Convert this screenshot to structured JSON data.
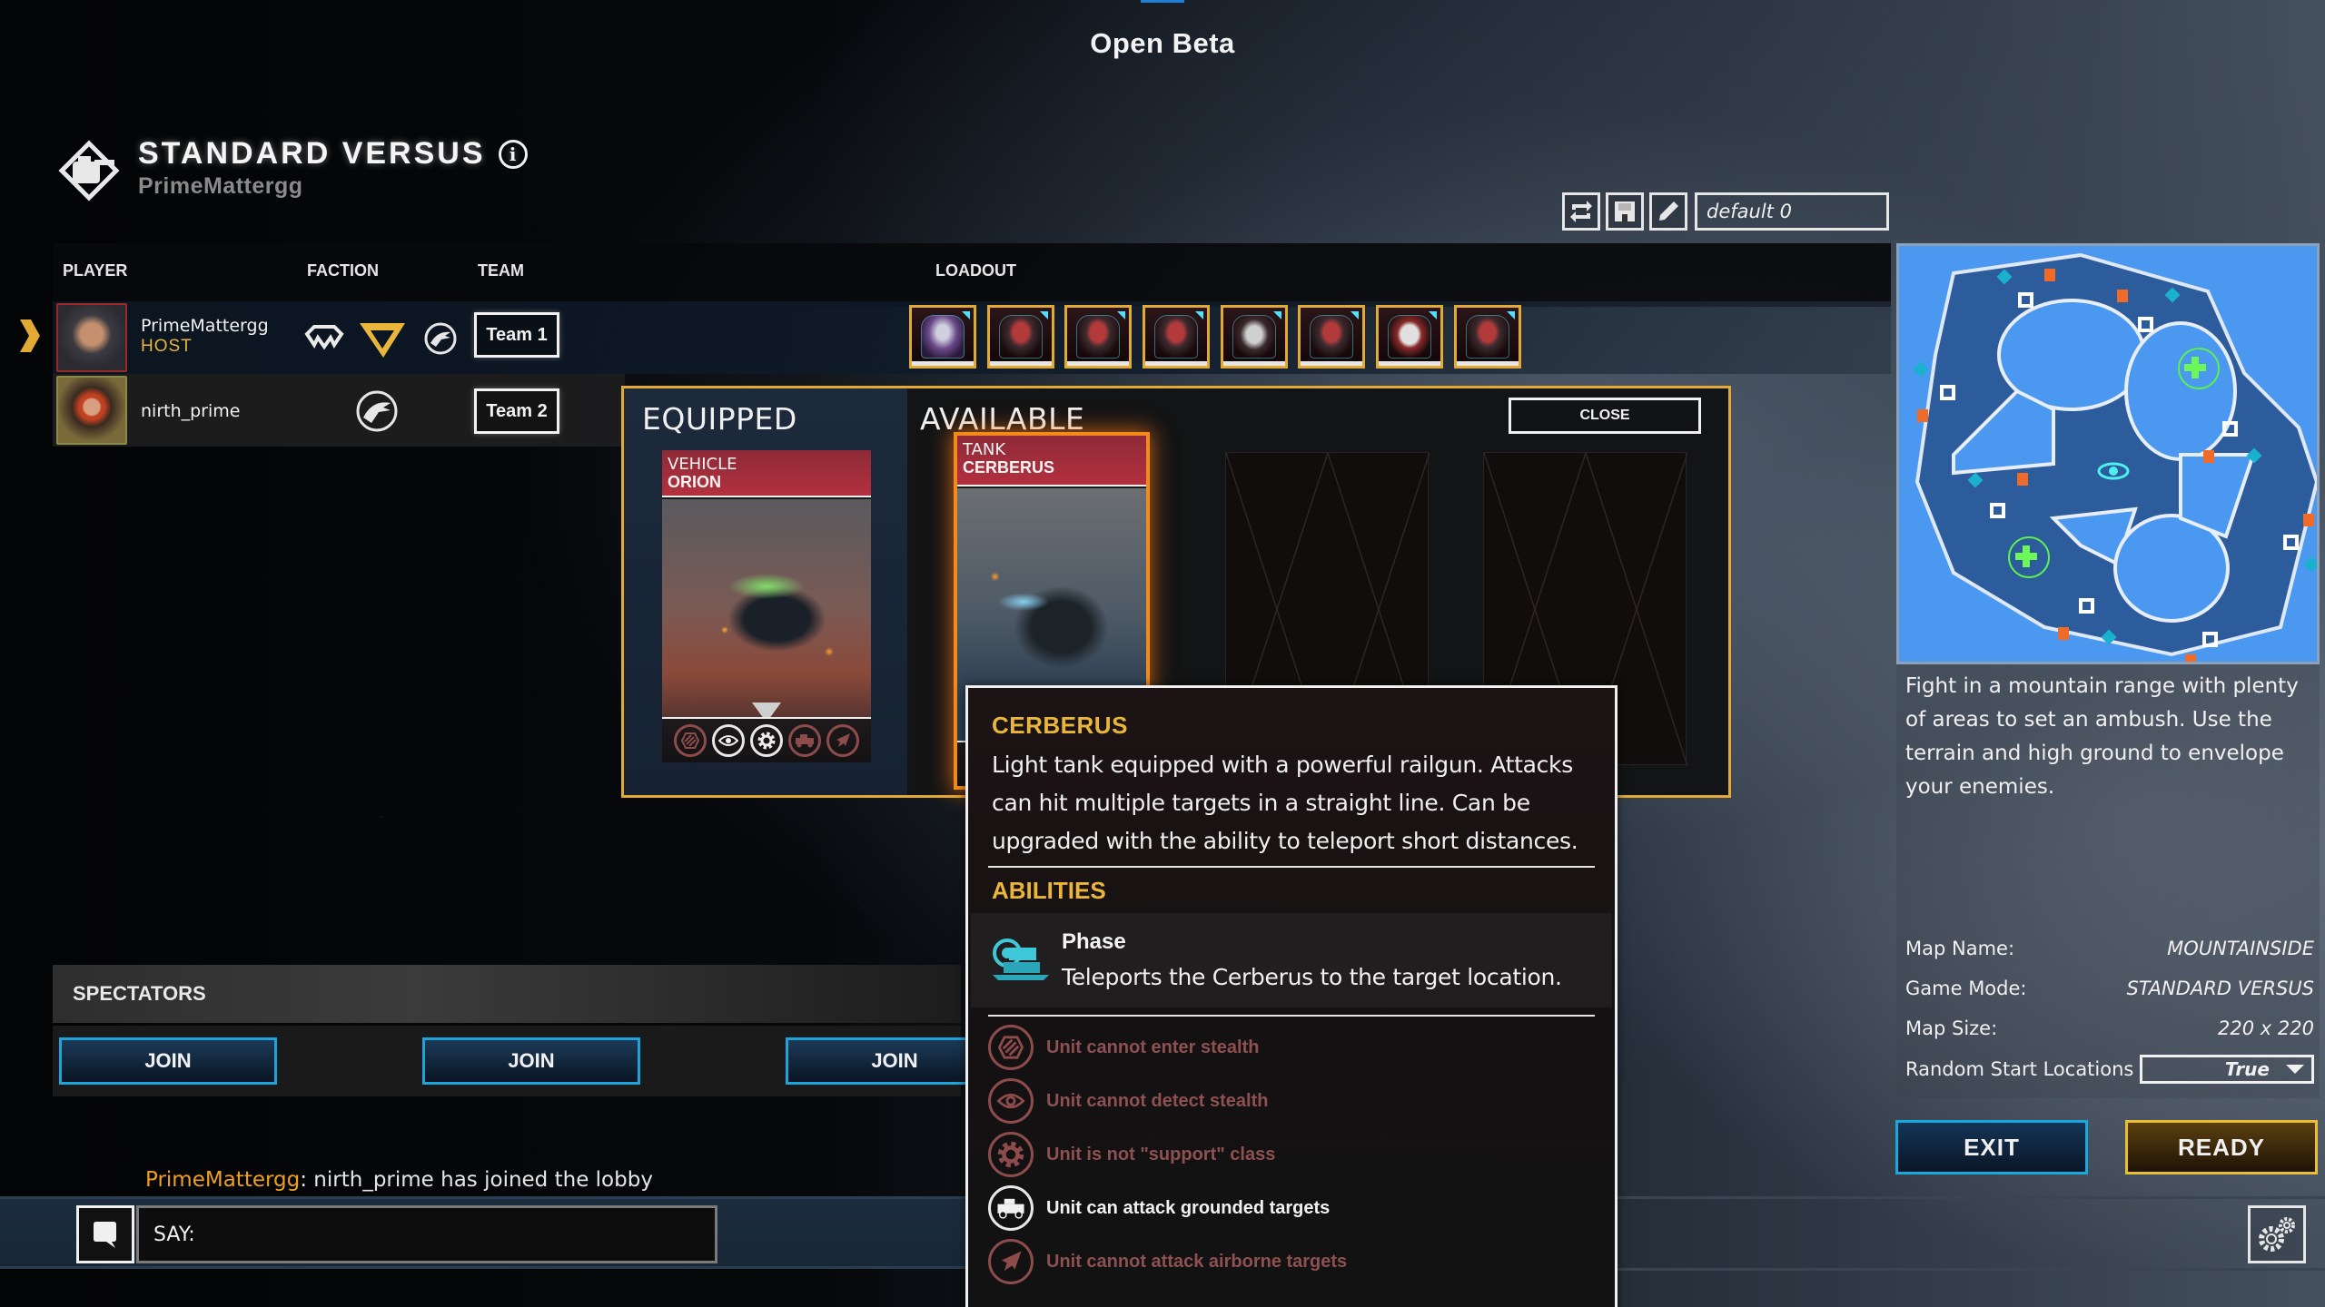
{
  "app": {
    "banner": "Open Beta"
  },
  "mode": {
    "title": "STANDARD VERSUS",
    "host_name": "PrimeMattergg"
  },
  "loadout_tools": {
    "preset_name": "default 0"
  },
  "columns": {
    "player": "PLAYER",
    "faction": "FACTION",
    "team": "TEAM",
    "loadout": "LOADOUT"
  },
  "players": [
    {
      "name": "PrimeMattergg",
      "role": "HOST",
      "team": "Team 1",
      "factions": [
        "wing-faction",
        "triangle-faction",
        "eagle-faction"
      ],
      "selected_faction": "triangle-faction"
    },
    {
      "name": "nirth_prime",
      "role": "",
      "team": "Team 2",
      "factions": [
        "eagle-faction"
      ]
    }
  ],
  "loadout_slots": [
    "commander",
    "infantry",
    "infantry",
    "tank",
    "vehicle",
    "aircraft",
    "gunship",
    "mech"
  ],
  "picker": {
    "equipped_title": "EQUIPPED",
    "available_title": "AVAILABLE",
    "close_label": "CLOSE",
    "equipped_card": {
      "type": "VEHICLE",
      "name": "ORION"
    },
    "available_card": {
      "type": "TANK",
      "name": "CERBERUS"
    }
  },
  "tooltip": {
    "title": "CERBERUS",
    "description": "Light tank equipped with a powerful railgun. Attacks can hit multiple targets in a straight line. Can be upgraded with the ability to teleport short distances.",
    "abilities_heading": "ABILITIES",
    "ability": {
      "name": "Phase",
      "description": "Teleports the Cerberus to the target location."
    },
    "traits": [
      {
        "icon": "stealth-icon",
        "label": "Unit cannot enter stealth",
        "active": false
      },
      {
        "icon": "eye-icon",
        "label": "Unit cannot detect stealth",
        "active": false
      },
      {
        "icon": "gear-icon",
        "label": "Unit is not \"support\" class",
        "active": false
      },
      {
        "icon": "ground-vehicle-icon",
        "label": "Unit can attack grounded targets",
        "active": true
      },
      {
        "icon": "jet-icon",
        "label": "Unit cannot attack airborne targets",
        "active": false
      }
    ]
  },
  "spectators": {
    "title": "SPECTATORS",
    "join_label": "JOIN"
  },
  "chat": {
    "author": "PrimeMattergg",
    "message": ": nirth_prime has joined the lobby",
    "input_placeholder": "SAY:"
  },
  "map": {
    "description": "Fight in a mountain range with plenty of areas to set an ambush. Use the terrain and high ground to envelope your enemies.",
    "name_label": "Map Name:",
    "name": "MOUNTAINSIDE",
    "mode_label": "Game Mode:",
    "mode": "STANDARD VERSUS",
    "size_label": "Map Size:",
    "size": "220 x 220",
    "random_label": "Random Start Locations",
    "random_value": "True"
  },
  "actions": {
    "exit": "EXIT",
    "ready": "READY"
  },
  "colors": {
    "accent_gold": "#e3a935",
    "accent_blue": "#17a9dd",
    "host": "#e9b53a",
    "disabled_trait": "#8e4b4b"
  }
}
